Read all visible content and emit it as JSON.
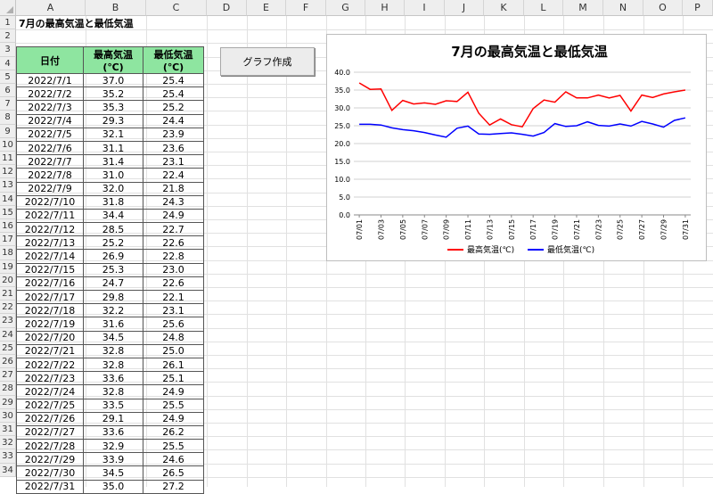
{
  "sheet": {
    "columns": [
      "A",
      "B",
      "C",
      "D",
      "E",
      "F",
      "G",
      "H",
      "I",
      "J",
      "K",
      "L",
      "M",
      "N",
      "O",
      "P"
    ],
    "rows": [
      "1",
      "2",
      "3",
      "4",
      "5",
      "6",
      "7",
      "8",
      "9",
      "10",
      "11",
      "12",
      "13",
      "14",
      "15",
      "16",
      "17",
      "18",
      "19",
      "20",
      "21",
      "22",
      "23",
      "24",
      "25",
      "26",
      "27",
      "28",
      "29",
      "30",
      "31",
      "32",
      "33",
      "34"
    ],
    "title": "7月の最高気温と最低気温",
    "headers": [
      "日付",
      "最高気温(℃)",
      "最低気温(℃)"
    ],
    "data": [
      [
        "2022/7/1",
        "37.0",
        "25.4"
      ],
      [
        "2022/7/2",
        "35.2",
        "25.4"
      ],
      [
        "2022/7/3",
        "35.3",
        "25.2"
      ],
      [
        "2022/7/4",
        "29.3",
        "24.4"
      ],
      [
        "2022/7/5",
        "32.1",
        "23.9"
      ],
      [
        "2022/7/6",
        "31.1",
        "23.6"
      ],
      [
        "2022/7/7",
        "31.4",
        "23.1"
      ],
      [
        "2022/7/8",
        "31.0",
        "22.4"
      ],
      [
        "2022/7/9",
        "32.0",
        "21.8"
      ],
      [
        "2022/7/10",
        "31.8",
        "24.3"
      ],
      [
        "2022/7/11",
        "34.4",
        "24.9"
      ],
      [
        "2022/7/12",
        "28.5",
        "22.7"
      ],
      [
        "2022/7/13",
        "25.2",
        "22.6"
      ],
      [
        "2022/7/14",
        "26.9",
        "22.8"
      ],
      [
        "2022/7/15",
        "25.3",
        "23.0"
      ],
      [
        "2022/7/16",
        "24.7",
        "22.6"
      ],
      [
        "2022/7/17",
        "29.8",
        "22.1"
      ],
      [
        "2022/7/18",
        "32.2",
        "23.1"
      ],
      [
        "2022/7/19",
        "31.6",
        "25.6"
      ],
      [
        "2022/7/20",
        "34.5",
        "24.8"
      ],
      [
        "2022/7/21",
        "32.8",
        "25.0"
      ],
      [
        "2022/7/22",
        "32.8",
        "26.1"
      ],
      [
        "2022/7/23",
        "33.6",
        "25.1"
      ],
      [
        "2022/7/24",
        "32.8",
        "24.9"
      ],
      [
        "2022/7/25",
        "33.5",
        "25.5"
      ],
      [
        "2022/7/26",
        "29.1",
        "24.9"
      ],
      [
        "2022/7/27",
        "33.6",
        "26.2"
      ],
      [
        "2022/7/28",
        "32.9",
        "25.5"
      ],
      [
        "2022/7/29",
        "33.9",
        "24.6"
      ],
      [
        "2022/7/30",
        "34.5",
        "26.5"
      ],
      [
        "2022/7/31",
        "35.0",
        "27.2"
      ]
    ]
  },
  "button": {
    "label": "グラフ作成"
  },
  "colors": {
    "header_fill": "#8ee5a0",
    "series_max": "#ff0000",
    "series_min": "#0000ff"
  },
  "chart_data": {
    "type": "line",
    "title": "7月の最高気温と最低気温",
    "x": [
      "07/01",
      "07/02",
      "07/03",
      "07/04",
      "07/05",
      "07/06",
      "07/07",
      "07/08",
      "07/09",
      "07/10",
      "07/11",
      "07/12",
      "07/13",
      "07/14",
      "07/15",
      "07/16",
      "07/17",
      "07/18",
      "07/19",
      "07/20",
      "07/21",
      "07/22",
      "07/23",
      "07/24",
      "07/25",
      "07/26",
      "07/27",
      "07/28",
      "07/29",
      "07/30",
      "07/31"
    ],
    "x_tick_labels": [
      "07/01",
      "07/03",
      "07/05",
      "07/07",
      "07/09",
      "07/11",
      "07/13",
      "07/15",
      "07/17",
      "07/19",
      "07/21",
      "07/23",
      "07/25",
      "07/27",
      "07/29",
      "07/31"
    ],
    "y_tick_labels": [
      "0.0",
      "5.0",
      "10.0",
      "15.0",
      "20.0",
      "25.0",
      "30.0",
      "35.0",
      "40.0"
    ],
    "ylim": [
      0,
      40
    ],
    "grid": true,
    "legend": "bottom",
    "series": [
      {
        "name": "最高気温(℃)",
        "color": "#ff0000",
        "values": [
          37.0,
          35.2,
          35.3,
          29.3,
          32.1,
          31.1,
          31.4,
          31.0,
          32.0,
          31.8,
          34.4,
          28.5,
          25.2,
          26.9,
          25.3,
          24.7,
          29.8,
          32.2,
          31.6,
          34.5,
          32.8,
          32.8,
          33.6,
          32.8,
          33.5,
          29.1,
          33.6,
          32.9,
          33.9,
          34.5,
          35.0
        ]
      },
      {
        "name": "最低気温(℃)",
        "color": "#0000ff",
        "values": [
          25.4,
          25.4,
          25.2,
          24.4,
          23.9,
          23.6,
          23.1,
          22.4,
          21.8,
          24.3,
          24.9,
          22.7,
          22.6,
          22.8,
          23.0,
          22.6,
          22.1,
          23.1,
          25.6,
          24.8,
          25.0,
          26.1,
          25.1,
          24.9,
          25.5,
          24.9,
          26.2,
          25.5,
          24.6,
          26.5,
          27.2
        ]
      }
    ]
  }
}
